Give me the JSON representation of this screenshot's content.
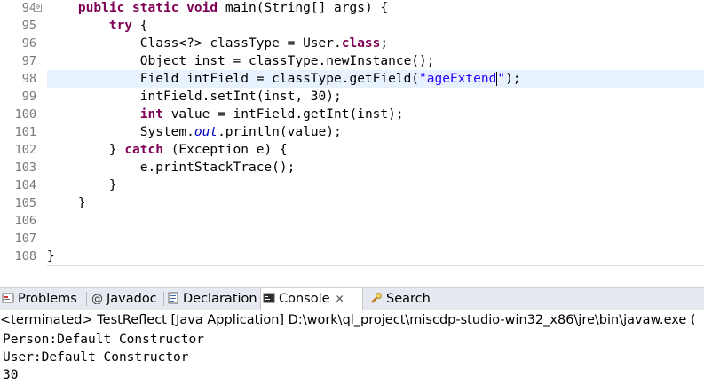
{
  "editor": {
    "lines": [
      {
        "num": "94",
        "tokens": [
          [
            "",
            "    "
          ],
          [
            "kw",
            "public"
          ],
          [
            "",
            " "
          ],
          [
            "kw",
            "static"
          ],
          [
            "",
            " "
          ],
          [
            "kw",
            "void"
          ],
          [
            "",
            " main(String[] args) {"
          ]
        ]
      },
      {
        "num": "95",
        "tokens": [
          [
            "",
            "        "
          ],
          [
            "kw",
            "try"
          ],
          [
            "",
            " {"
          ]
        ]
      },
      {
        "num": "96",
        "tokens": [
          [
            "",
            "            Class<?> classType = User."
          ],
          [
            "kw",
            "class"
          ],
          [
            "",
            ";"
          ]
        ]
      },
      {
        "num": "97",
        "tokens": [
          [
            "",
            "            Object inst = classType.newInstance();"
          ]
        ]
      },
      {
        "num": "98",
        "current": true,
        "tokens": [
          [
            "",
            "            Field intField = classType.getField("
          ],
          [
            "str",
            "\"ageExtend"
          ],
          [
            "caret",
            ""
          ],
          [
            "str",
            "\""
          ],
          [
            "",
            ");"
          ]
        ]
      },
      {
        "num": "99",
        "tokens": [
          [
            "",
            "            intField.setInt(inst, 30);"
          ]
        ]
      },
      {
        "num": "100",
        "tokens": [
          [
            "",
            "            "
          ],
          [
            "kw",
            "int"
          ],
          [
            "",
            " value = intField.getInt(inst);"
          ]
        ]
      },
      {
        "num": "101",
        "tokens": [
          [
            "",
            "            System."
          ],
          [
            "fld",
            "out"
          ],
          [
            "",
            ".println(value);"
          ]
        ]
      },
      {
        "num": "102",
        "tokens": [
          [
            "",
            "        } "
          ],
          [
            "kw",
            "catch"
          ],
          [
            "",
            " (Exception e) {"
          ]
        ]
      },
      {
        "num": "103",
        "tokens": [
          [
            "",
            "            e.printStackTrace();"
          ]
        ]
      },
      {
        "num": "104",
        "tokens": [
          [
            "",
            "        }"
          ]
        ]
      },
      {
        "num": "105",
        "tokens": [
          [
            "",
            "    }"
          ]
        ]
      },
      {
        "num": "106",
        "tokens": [
          [
            "",
            ""
          ]
        ]
      },
      {
        "num": "107",
        "tokens": [
          [
            "",
            ""
          ]
        ]
      },
      {
        "num": "108",
        "tokens": [
          [
            "",
            "}"
          ]
        ]
      }
    ],
    "fold_marker": "⊖",
    "hscroll_arrow": "◂"
  },
  "tabs": [
    {
      "label": "Problems",
      "icon": "problems-icon",
      "active": false
    },
    {
      "label": "Javadoc",
      "icon": "at-icon",
      "active": false
    },
    {
      "label": "Declaration",
      "icon": "declaration-icon",
      "active": false
    },
    {
      "label": "Console",
      "icon": "console-icon",
      "active": true,
      "close": "✕"
    },
    {
      "label": "Search",
      "icon": "search-icon",
      "active": false
    }
  ],
  "console": {
    "header": "<terminated> TestReflect [Java Application] D:\\work\\ql_project\\miscdp-studio-win32_x86\\jre\\bin\\javaw.exe (",
    "output": [
      "Person:Default Constructor",
      "User:Default Constructor",
      "30"
    ]
  },
  "colors": {
    "keyword": "#7f0055",
    "string": "#2a00ff",
    "static_field": "#0000c0",
    "current_line": "#e8f2fe",
    "line_number": "#787878"
  }
}
